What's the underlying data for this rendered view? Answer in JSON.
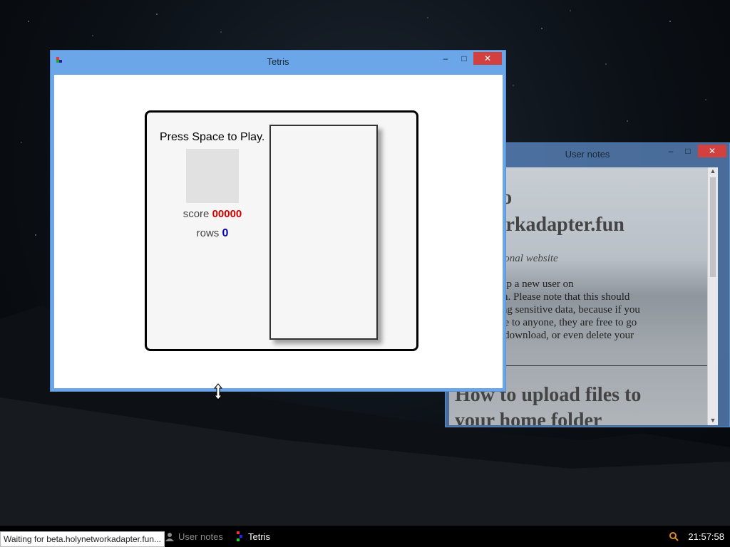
{
  "tetris_window": {
    "title": "Tetris",
    "prompt": "Press Space to Play.",
    "score_label": "score",
    "score_value": "00000",
    "rows_label": "rows",
    "rows_value": "0",
    "minimize_glyph": "–",
    "maximize_glyph": "□",
    "close_glyph": "✕"
  },
  "notes_window": {
    "title": "User notes",
    "heading1": "ome to\nnetworkadapter.fun",
    "subtitle": "ktop + personal website",
    "paragraph": " for setting up a new user on\nkadapter.fun. Please note that this should\ned for storing sensitive data, because if you\nccount name to anyone, they are free to go\nccount and download, or even delete your",
    "heading2": "How to upload files to\nyour home folder",
    "minimize_glyph": "–",
    "maximize_glyph": "□",
    "close_glyph": "✕"
  },
  "taskbar": {
    "items": [
      {
        "label": "User notes",
        "icon": "user-icon"
      },
      {
        "label": "Tetris",
        "icon": "tetris-icon"
      }
    ],
    "clock": "21:57:58",
    "status_tip": "Waiting for beta.holynetworkadapter.fun..."
  },
  "colors": {
    "titlebar": "#6aa6e8",
    "close": "#d24040",
    "score": "#d40000",
    "rows": "#0000b8"
  }
}
